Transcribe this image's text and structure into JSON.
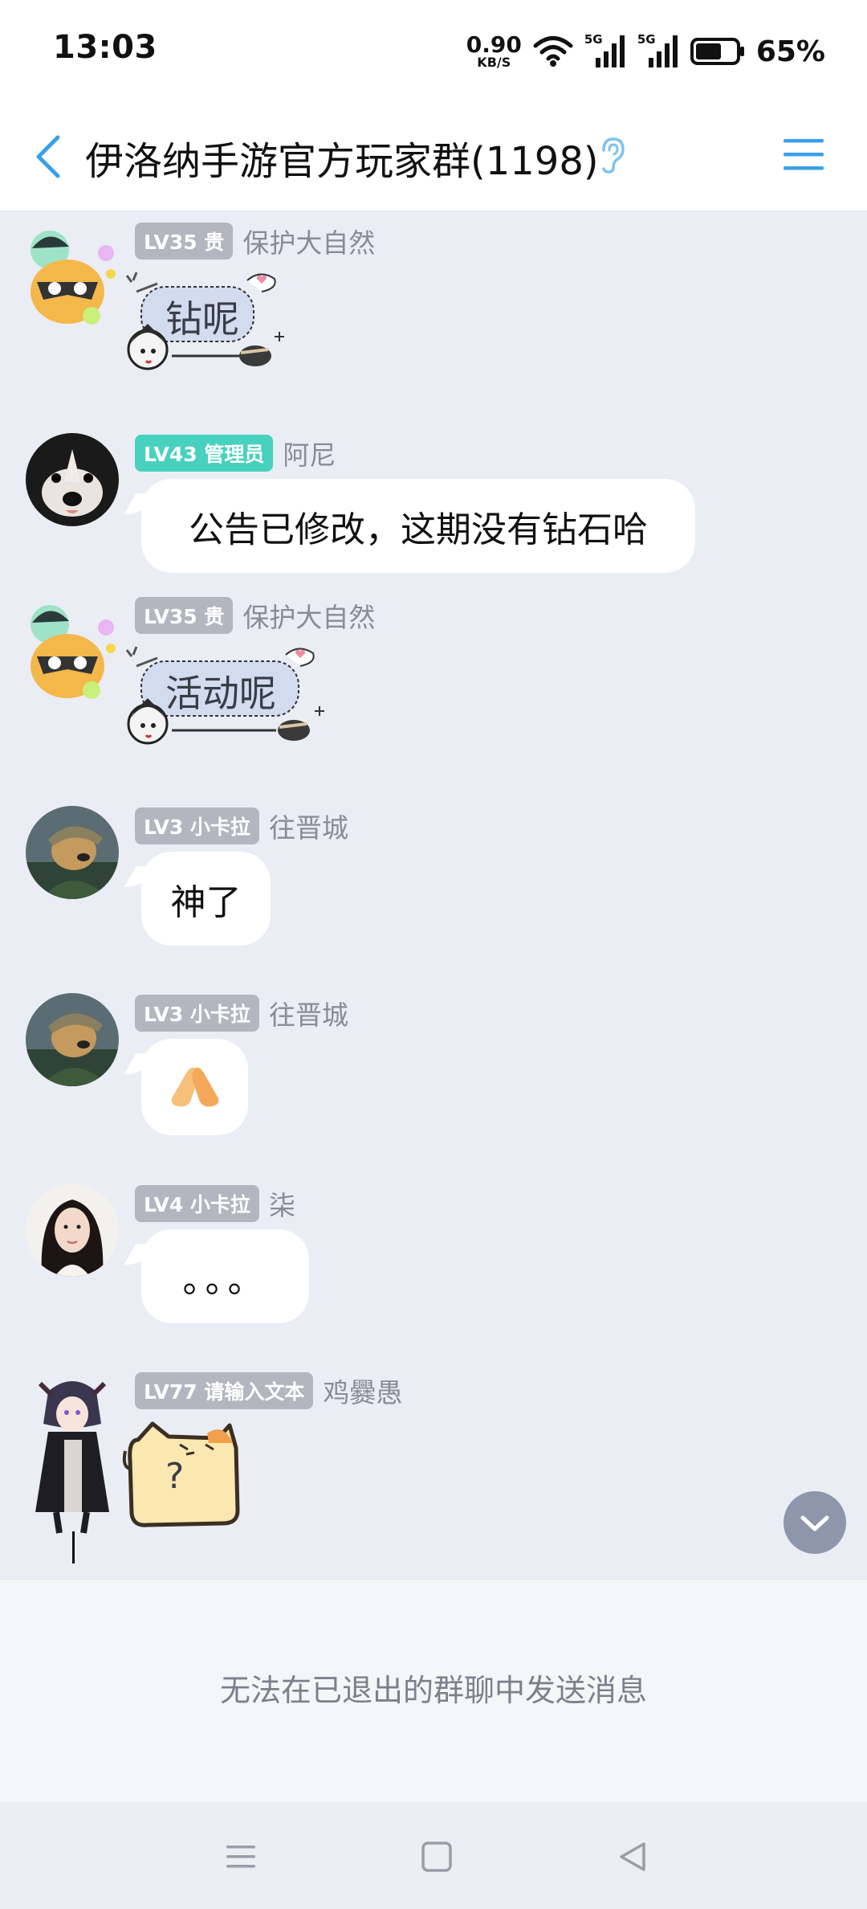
{
  "status_bar": {
    "time": "13:03",
    "net_speed_value": "0.90",
    "net_speed_unit": "KB/S",
    "sim1_label": "5G",
    "sim2_label": "5G",
    "battery_percent": "65%",
    "battery_level": 0.65
  },
  "header": {
    "title": "伊洛纳手游官方玩家群(1198)",
    "back_icon": "chevron-left-icon",
    "ear_icon": "ear-icon",
    "menu_icon": "hamburger-menu-icon",
    "accent_color": "#3aa0e8"
  },
  "messages": [
    {
      "level_badge": "LV35 贵",
      "badge_color": "gray",
      "nickname": "保护大自然",
      "type": "sticker",
      "text": "钻呢"
    },
    {
      "level_badge": "LV43 管理员",
      "badge_color": "teal",
      "nickname": "阿尼",
      "type": "text",
      "text": "公告已修改，这期没有钻石哈"
    },
    {
      "level_badge": "LV35 贵",
      "badge_color": "gray",
      "nickname": "保护大自然",
      "type": "sticker",
      "text": "活动呢"
    },
    {
      "level_badge": "LV3 小卡拉",
      "badge_color": "gray",
      "nickname": "往晋城",
      "type": "text",
      "text": "神了"
    },
    {
      "level_badge": "LV3 小卡拉",
      "badge_color": "gray",
      "nickname": "往晋城",
      "type": "emoji",
      "text": "pray-hands-emoji"
    },
    {
      "level_badge": "LV4 小卡拉",
      "badge_color": "gray",
      "nickname": "柒",
      "type": "text",
      "text": "。。。"
    },
    {
      "level_badge": "LV77 请输入文本",
      "badge_color": "gray",
      "nickname": "鸡爨愚",
      "type": "sticker",
      "text": "?"
    }
  ],
  "footer": {
    "notice": "无法在已退出的群聊中发送消息",
    "scroll_down_icon": "chevron-down-icon"
  },
  "nav_bar": {
    "menu_icon": "recent-apps-icon",
    "home_icon": "home-square-icon",
    "back_icon": "back-triangle-icon"
  }
}
